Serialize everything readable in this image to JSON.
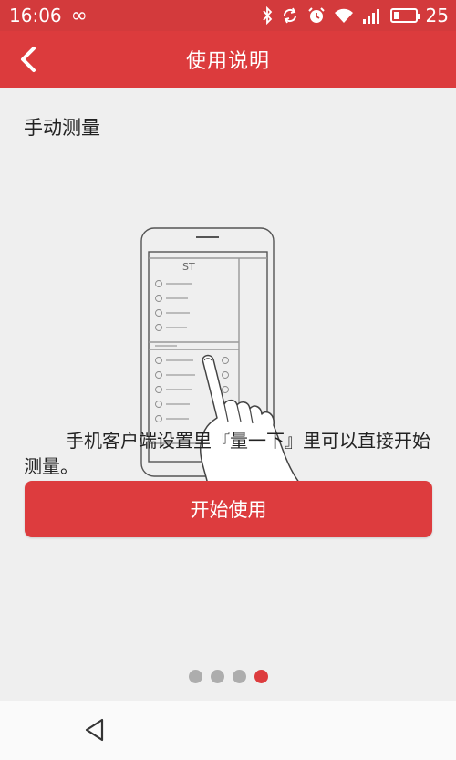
{
  "status_bar": {
    "time": "16:06",
    "infinity_glyph": "∞",
    "battery_level": "25",
    "battery_fraction": 0.25
  },
  "header": {
    "title": "使用说明",
    "back_icon": "chevron-left-icon"
  },
  "main": {
    "section_title": "手动测量",
    "description": "手机客户端设置里『量一下』里可以直接开始测量。",
    "start_button_label": "开始使用"
  },
  "pager": {
    "total": 4,
    "active_index": 3
  },
  "colors": {
    "accent": "#dc3b3d",
    "dot_inactive": "#adadad",
    "background": "#efefef"
  },
  "nav": {
    "back_icon": "triangle-back-icon"
  }
}
